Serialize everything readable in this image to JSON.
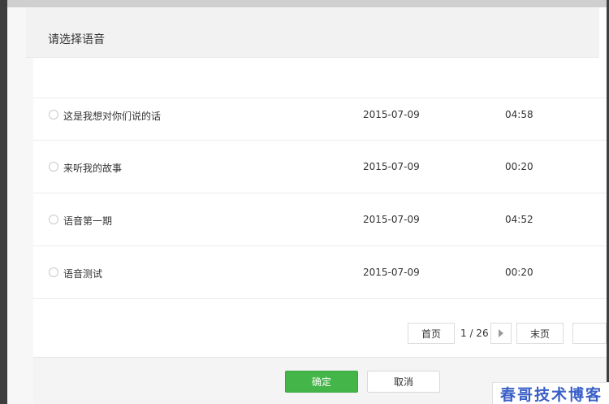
{
  "dialog": {
    "title": "请选择语音"
  },
  "voices": [
    {
      "title": "这是我想对你们说的话",
      "date": "2015-07-09",
      "duration": "04:58"
    },
    {
      "title": "来听我的故事",
      "date": "2015-07-09",
      "duration": "00:20"
    },
    {
      "title": "语音第一期",
      "date": "2015-07-09",
      "duration": "04:52"
    },
    {
      "title": "语音测试",
      "date": "2015-07-09",
      "duration": "00:20"
    }
  ],
  "pager": {
    "first_label": "首页",
    "page_indicator": "1 / 26",
    "next_icon": "triangle-right-icon",
    "last_label": "末页",
    "jump_input_value": ""
  },
  "footer": {
    "confirm_label": "确定",
    "cancel_label": "取消"
  },
  "watermark": {
    "text": "春哥技术博客"
  },
  "colors": {
    "primary": "#44b549",
    "watermark": "#3a5fc8"
  }
}
